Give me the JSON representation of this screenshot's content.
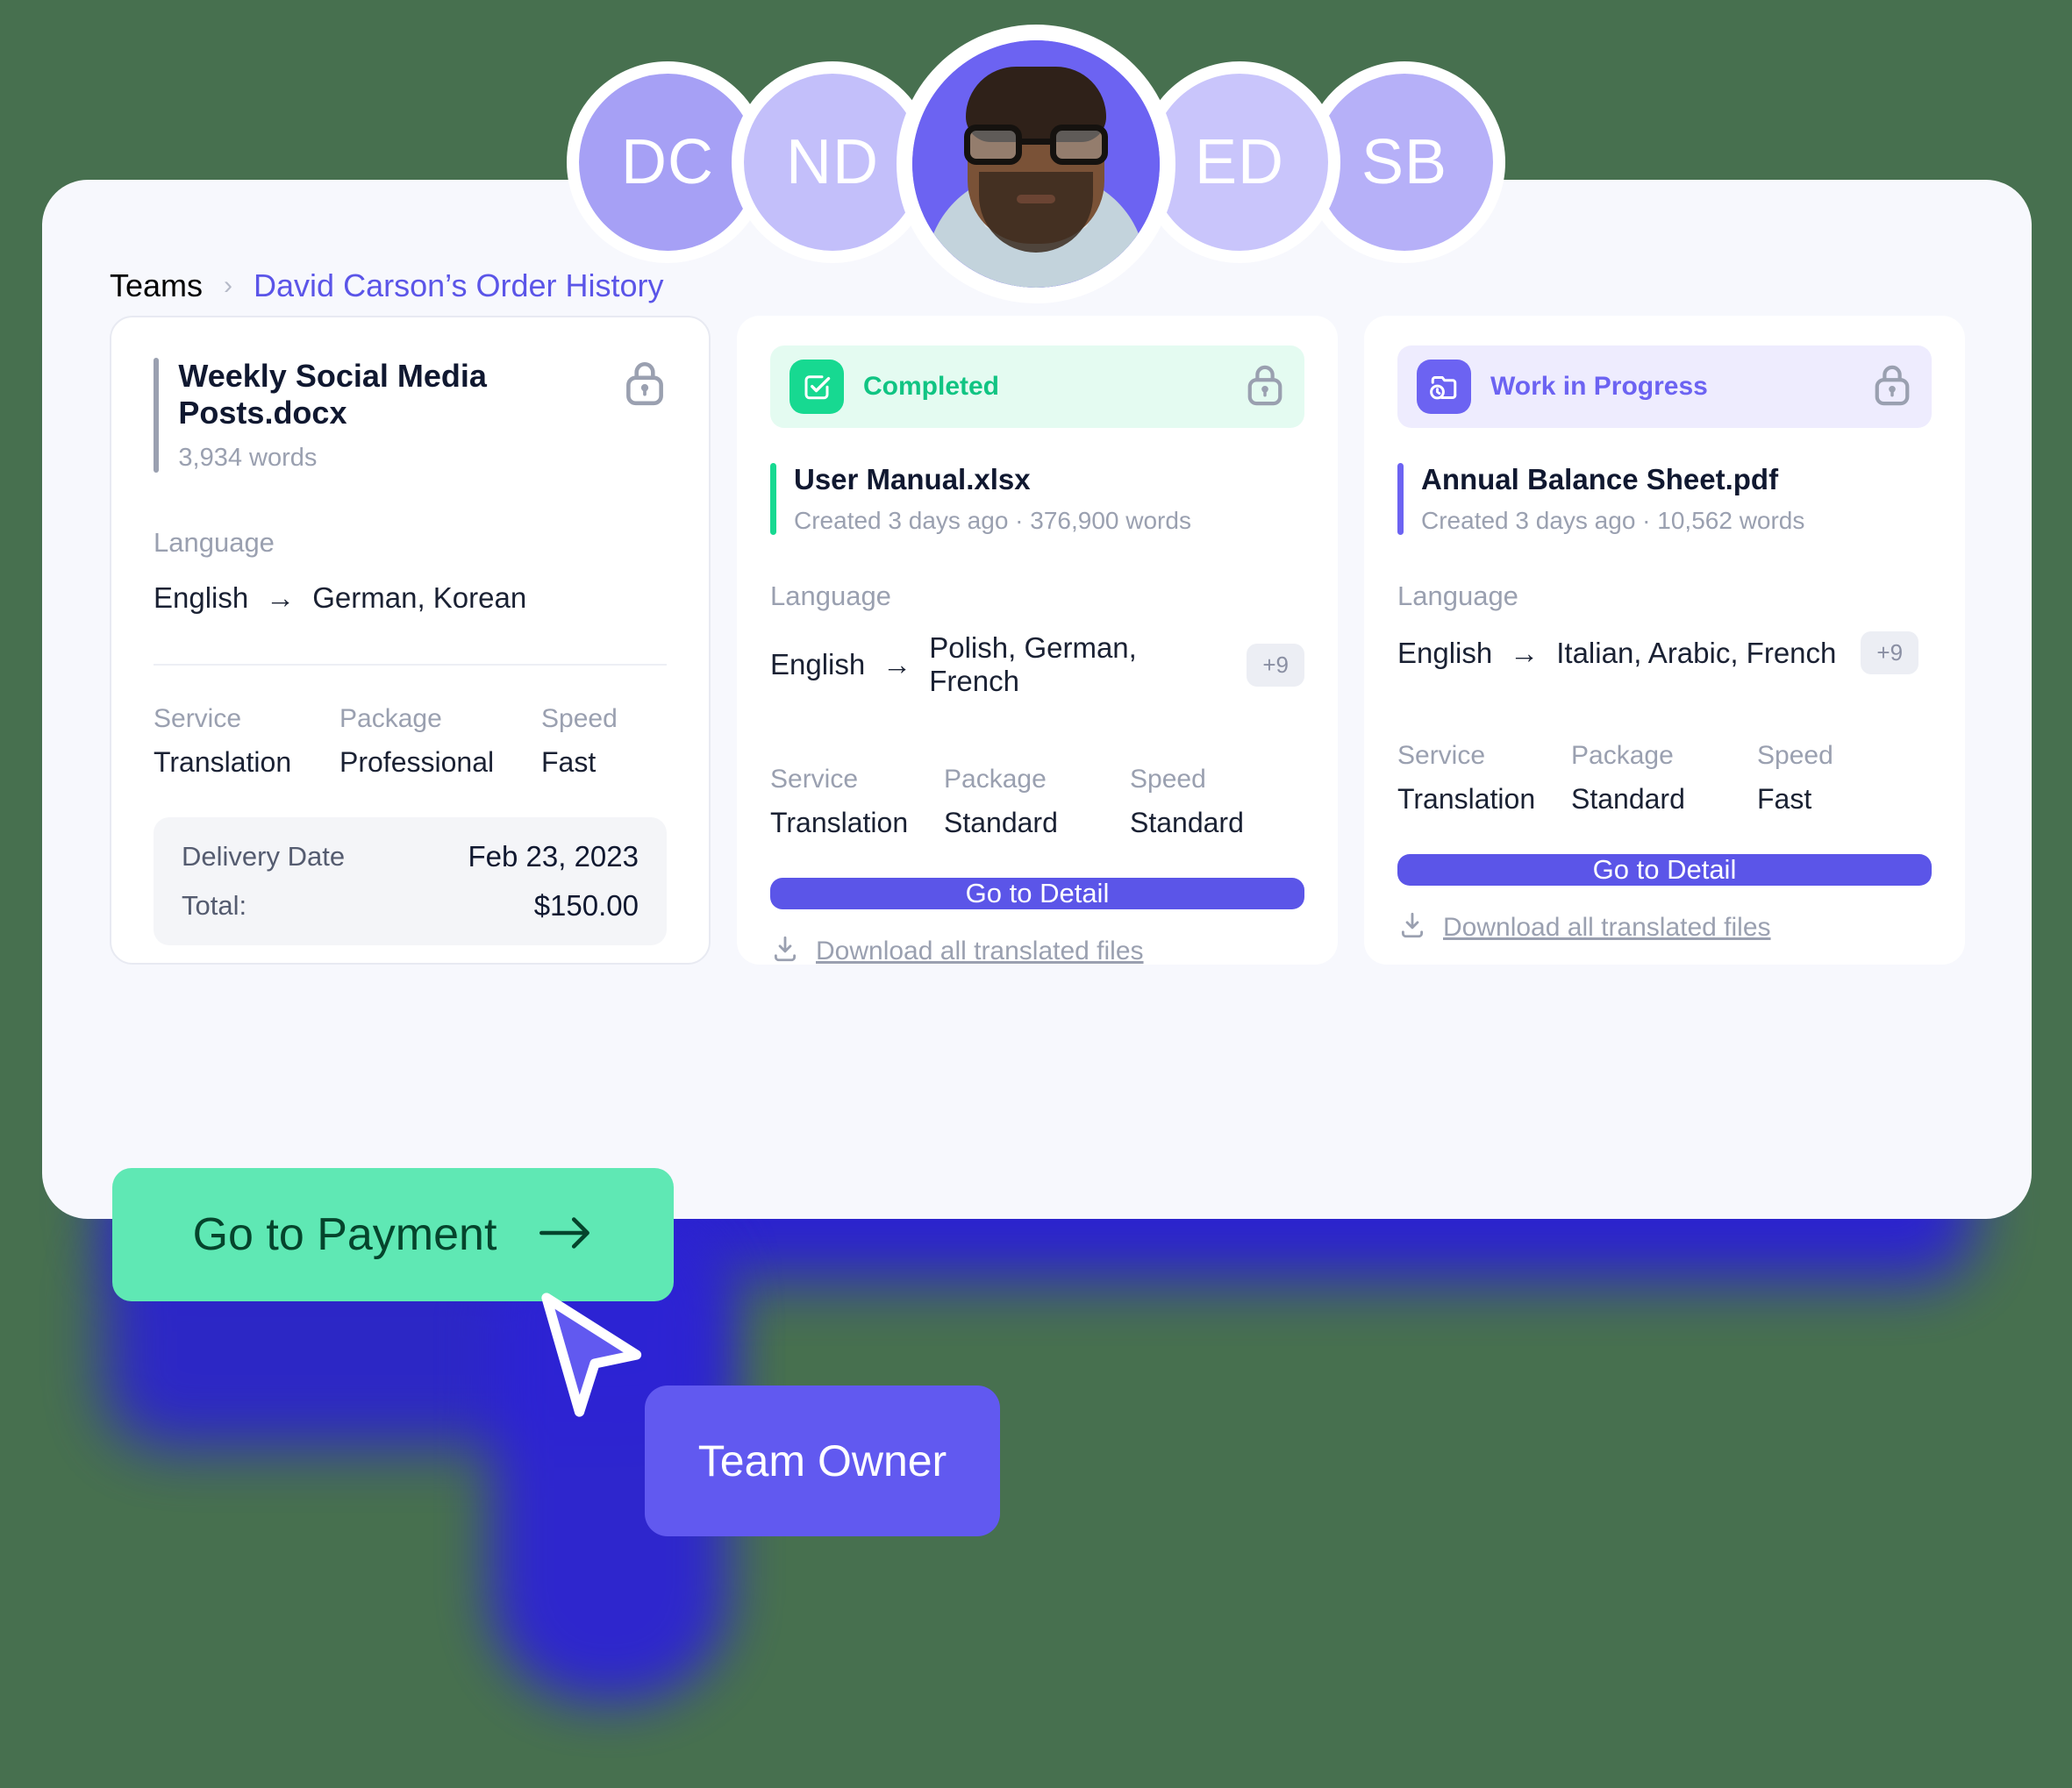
{
  "theme": {
    "page_bg": "#47704f",
    "panel_bg": "#f7f8fd",
    "accent_purple": "#5b55e8",
    "accent_green": "#17d991",
    "mint": "#5fe8b4",
    "glow_blue": "#2a1fd6"
  },
  "avatars": [
    {
      "initials": "DC",
      "type": "initials",
      "color": "#a6a0f5"
    },
    {
      "initials": "ND",
      "type": "initials",
      "color": "#c3bffa"
    },
    {
      "initials": "",
      "type": "photo",
      "color": "#6c63f2"
    },
    {
      "initials": "ED",
      "type": "initials",
      "color": "#c9c5fb"
    },
    {
      "initials": "SB",
      "type": "initials",
      "color": "#b6b0f8"
    }
  ],
  "breadcrumb": {
    "root": "Teams",
    "separator": "›",
    "current": "David Carson’s Order History"
  },
  "cards": [
    {
      "file_name": "Weekly Social Media Posts.docx",
      "word_count": "3,934 words",
      "lock_icon": "lock-icon",
      "accent": "#9aa0b0",
      "language_label": "Language",
      "source_language": "English",
      "arrow": "→",
      "target_languages": "German, Korean",
      "extra_count": "",
      "details_headers": [
        "Service",
        "Package",
        "Speed"
      ],
      "details_values": [
        "Translation",
        "Professional",
        "Fast"
      ],
      "totals": [
        {
          "key": "Delivery Date",
          "value": "Feb 23, 2023"
        },
        {
          "key": "Total:",
          "value": "$150.00"
        }
      ]
    },
    {
      "status": "Completed",
      "status_icon": "check-square-icon",
      "status_color": "#11c483",
      "lock_icon": "lock-icon",
      "accent": "#17d991",
      "file_name": "User Manual.xlsx",
      "meta": "Created 3 days ago  ·  376,900 words",
      "language_label": "Language",
      "source_language": "English",
      "arrow": "→",
      "target_languages": "Polish, German, French",
      "extra_count": "+9",
      "details_headers": [
        "Service",
        "Package",
        "Speed"
      ],
      "details_values": [
        "Translation",
        "Standard",
        "Standard"
      ],
      "detail_button": "Go to Detail",
      "download_link": "Download all translated files",
      "download_icon": "download-icon"
    },
    {
      "status": "Work in Progress",
      "status_icon": "folder-clock-icon",
      "status_color": "#6c63f2",
      "lock_icon": "lock-icon",
      "accent": "#6c63f2",
      "file_name": "Annual Balance Sheet.pdf",
      "meta": "Created 3 days ago  ·  10,562 words",
      "language_label": "Language",
      "source_language": "English",
      "arrow": "→",
      "target_languages": "Italian, Arabic, French",
      "extra_count": "+9",
      "details_headers": [
        "Service",
        "Package",
        "Speed"
      ],
      "details_values": [
        "Translation",
        "Standard",
        "Fast"
      ],
      "detail_button": "Go to Detail",
      "download_link": "Download all translated files",
      "download_icon": "download-icon"
    }
  ],
  "payment_button": {
    "label": "Go to Payment",
    "arrow_icon": "arrow-right-icon"
  },
  "owner_badge": {
    "label": "Team Owner"
  },
  "cursor": {
    "icon": "mouse-pointer-icon"
  }
}
